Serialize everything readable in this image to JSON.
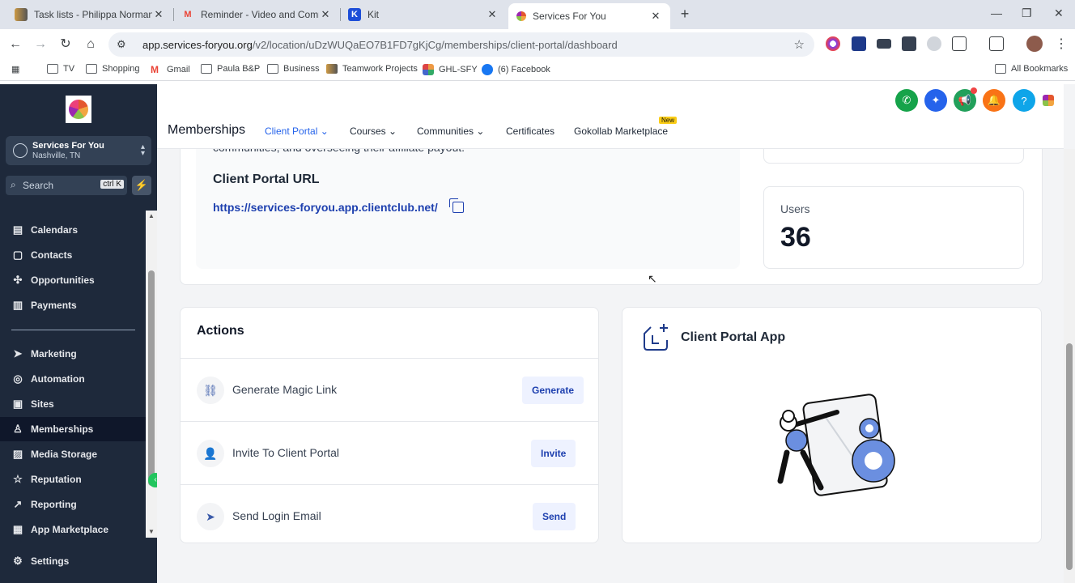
{
  "browser": {
    "tabs": [
      {
        "title": "Task lists - Philippa Norman - S",
        "favicon": "teamwork-icon",
        "close": "✕"
      },
      {
        "title": "Reminder - Video and Commun",
        "favicon": "gmail-icon",
        "close": "✕"
      },
      {
        "title": "Kit",
        "favicon": "kit-icon",
        "close": "✕"
      },
      {
        "title": "Services For You",
        "favicon": "flower-icon",
        "close": "✕"
      }
    ],
    "new_tab": "+",
    "url_host": "app.services-foryou.org",
    "url_path": "/v2/location/uDzWUQaEO7B1FD7gKjCg/memberships/client-portal/dashboard",
    "bookmarks": [
      "TV",
      "Shopping",
      "Gmail",
      "Paula B&P",
      "Business",
      "Teamwork Projects",
      "GHL-SFY",
      "(6) Facebook"
    ],
    "all_bookmarks": "All Bookmarks"
  },
  "sidebar": {
    "account_name": "Services For You",
    "account_location": "Nashville, TN",
    "search_placeholder": "Search",
    "search_shortcut": "ctrl K",
    "items": [
      {
        "label": "Calendars",
        "icon": "calendar-icon"
      },
      {
        "label": "Contacts",
        "icon": "contacts-icon"
      },
      {
        "label": "Opportunities",
        "icon": "opportunities-icon"
      },
      {
        "label": "Payments",
        "icon": "payments-icon"
      },
      {
        "label": "Marketing",
        "icon": "marketing-icon"
      },
      {
        "label": "Automation",
        "icon": "automation-icon"
      },
      {
        "label": "Sites",
        "icon": "sites-icon"
      },
      {
        "label": "Memberships",
        "icon": "memberships-icon"
      },
      {
        "label": "Media Storage",
        "icon": "media-icon"
      },
      {
        "label": "Reputation",
        "icon": "star-icon"
      },
      {
        "label": "Reporting",
        "icon": "reporting-icon"
      },
      {
        "label": "App Marketplace",
        "icon": "marketplace-icon"
      },
      {
        "label": "Settings",
        "icon": "gear-icon"
      }
    ],
    "active_item": "Memberships"
  },
  "header": {
    "title": "Memberships",
    "tabs": [
      {
        "label": "Client Portal",
        "dropdown": true
      },
      {
        "label": "Courses",
        "dropdown": true
      },
      {
        "label": "Communities",
        "dropdown": true
      },
      {
        "label": "Certificates",
        "dropdown": false
      },
      {
        "label": "Gokollab Marketplace",
        "dropdown": false
      }
    ],
    "active_tab": "Client Portal",
    "new_badge": "New"
  },
  "portal": {
    "truncated_text": "communities, and overseeing their affiliate payout.",
    "url_label": "Client Portal URL",
    "url": "https://services-foryou.app.clientclub.net/",
    "users_label": "Users",
    "users_count": "36"
  },
  "actions": {
    "title": "Actions",
    "rows": [
      {
        "label": "Generate Magic Link",
        "button": "Generate",
        "icon": "magic-link-icon"
      },
      {
        "label": "Invite To Client Portal",
        "button": "Invite",
        "icon": "add-user-icon"
      },
      {
        "label": "Send Login Email",
        "button": "Send",
        "icon": "send-icon"
      }
    ]
  },
  "app_card": {
    "title": "Client Portal App"
  },
  "colors": {
    "sidebar_bg": "#1e293b",
    "accent": "#2563eb",
    "link": "#1e40af"
  }
}
